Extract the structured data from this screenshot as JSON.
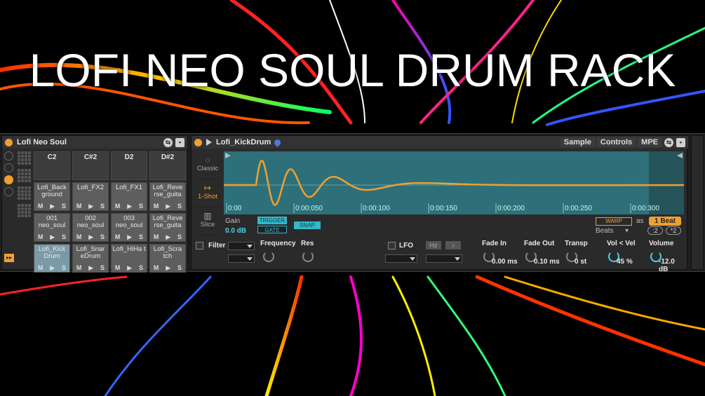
{
  "title": "LOFI NEO SOUL DRUM RACK",
  "colors": {
    "accent": "#f0a030",
    "waveform_bg": "#2e7079",
    "waveform_line": "#f0a030",
    "cyan": "#4fd0e8"
  },
  "drum_rack": {
    "name": "Lofi Neo Soul",
    "pad_rows": [
      [
        {
          "name": "C2",
          "state": "empty"
        },
        {
          "name": "C#2",
          "state": "empty"
        },
        {
          "name": "D2",
          "state": "empty"
        },
        {
          "name": "D#2",
          "state": "empty"
        }
      ],
      [
        {
          "name": "Lofi_Back ground",
          "state": "filled"
        },
        {
          "name": "Lofi_FX2",
          "state": "filled"
        },
        {
          "name": "Lofi_FX1",
          "state": "filled"
        },
        {
          "name": "Lofi_Reve rse_guita",
          "state": "filled"
        }
      ],
      [
        {
          "name": "001 neo_soul",
          "state": "filled"
        },
        {
          "name": "002 neo_soul",
          "state": "filled"
        },
        {
          "name": "003 neo_soul",
          "state": "filled"
        },
        {
          "name": "Lofi_Reve rse_guita",
          "state": "filled"
        }
      ],
      [
        {
          "name": "Lofi_Kick Drum",
          "state": "selected"
        },
        {
          "name": "Lofi_Snar eDrum",
          "state": "filled"
        },
        {
          "name": "Lofi_HiHa t",
          "state": "filled"
        },
        {
          "name": "Lofi_Scra tch",
          "state": "filled"
        }
      ]
    ],
    "pad_controls": {
      "mute": "M",
      "play": "▶",
      "solo": "S"
    }
  },
  "simpler": {
    "name": "Lofi_KickDrum",
    "tabs": [
      "Sample",
      "Controls",
      "MPE"
    ],
    "modes": [
      {
        "label": "Classic",
        "icon": "classic-icon",
        "active": false
      },
      {
        "label": "1-Shot",
        "icon": "one-shot-icon",
        "active": true
      },
      {
        "label": "Slice",
        "icon": "slice-icon",
        "active": false
      }
    ],
    "time_marks": [
      "0:00",
      "0:00:050",
      "0:00:100",
      "0:00:150",
      "0:00:200",
      "0:00:250",
      "0:00:300"
    ],
    "gain_label": "Gain",
    "gain_value": "0.0 dB",
    "trigger_label": "TRIGGER",
    "gate_label": "GATE",
    "snap_label": "SNAP",
    "warp_label": "WARP",
    "as_label": "as",
    "beat_value": "1 Beat",
    "beats_label": "Beats",
    "div2": ":2",
    "mul2": "*2",
    "filter_label": "Filter",
    "frequency_label": "Frequency",
    "res_label": "Res",
    "lfo_label": "LFO",
    "hz_label": "Hz",
    "knobs": [
      {
        "label": "Fade In",
        "value": "0.00 ms"
      },
      {
        "label": "Fade Out",
        "value": "0.10 ms"
      },
      {
        "label": "Transp",
        "value": "0 st"
      },
      {
        "label": "Vol < Vel",
        "value": "45 %"
      },
      {
        "label": "Volume",
        "value": "-12.0 dB"
      }
    ]
  }
}
